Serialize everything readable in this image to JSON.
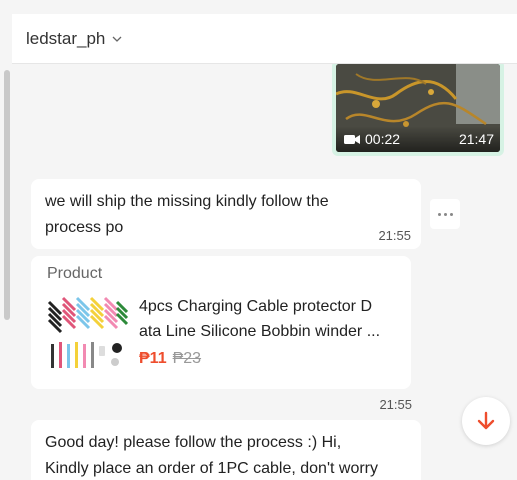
{
  "header": {
    "name": "ledstar_ph"
  },
  "video_message": {
    "duration": "00:22",
    "time": "21:47"
  },
  "messages": [
    {
      "text_lines": [
        "we will ship the missing kindly follow the",
        "process po"
      ],
      "time": "21:55"
    }
  ],
  "product_card": {
    "header": "Product",
    "title_line1": "4pcs Charging Cable protector D",
    "title_line2": "ata Line Silicone Bobbin winder ...",
    "price": "₱11",
    "old_price": "₱23",
    "time": "21:55"
  },
  "last_message": {
    "text_lines": [
      "Good day! please follow the process :) Hi,",
      "Kindly place an order of 1PC cable, don't worry"
    ]
  },
  "colors": {
    "accent": "#ee4d2d",
    "video_border": "#d6f2e4"
  }
}
